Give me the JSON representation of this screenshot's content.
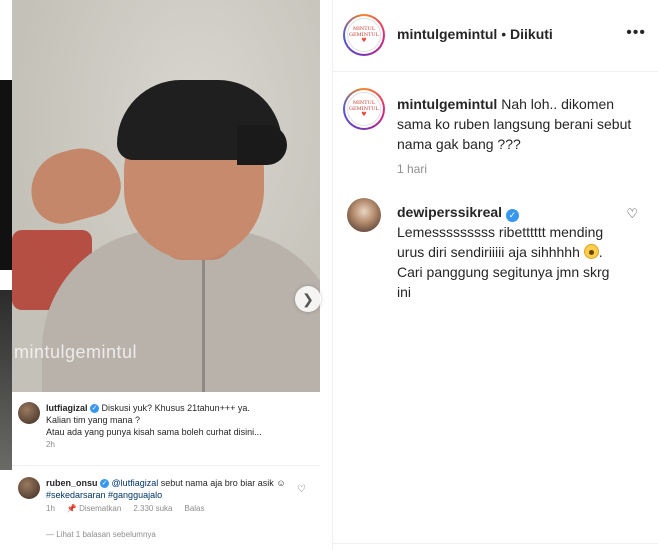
{
  "media": {
    "watermark": "mintulgemintul",
    "next_icon": "chevron-right-icon"
  },
  "embed_comment": {
    "user": "lutfiagizal",
    "text_line1": "Diskusi yuk? Khusus 21tahun+++ ya.",
    "text_line2": "Kalian tim yang mana ?",
    "text_line3": "Atau ada yang punya kisah sama boleh curhat disini...",
    "time": "2h"
  },
  "embed_reply": {
    "user": "ruben_onsu",
    "mention": "@lutfiagizal",
    "text": "sebut nama aja bro biar asik",
    "hashtags": "#sekedarsaran #gangguajalo",
    "time": "1h",
    "pinned": "Disematkan",
    "likes": "2.330 suka",
    "reply": "Balas",
    "view_replies": "Lihat 1 balasan sebelumnya"
  },
  "header": {
    "username": "mintulgemintul",
    "separator": "•",
    "follow_status": "Diikuti",
    "options_icon": "more-options-icon",
    "logo_line1": "MINTUL",
    "logo_line2": "GEMINTUL"
  },
  "caption": {
    "username": "mintulgemintul",
    "text": "Nah loh.. dikomen sama ko ruben langsung berani sebut nama gak bang ???",
    "time": "1 hari"
  },
  "comment": {
    "username": "dewiperssikreal",
    "text_before_emoji": "Lemesssssssss ribetttttt mending urus diri sendiriiiii aja sihhhhh",
    "text_after_emoji": ". Cari panggung segitunya jmn skrg ini",
    "like_icon": "heart-icon"
  }
}
